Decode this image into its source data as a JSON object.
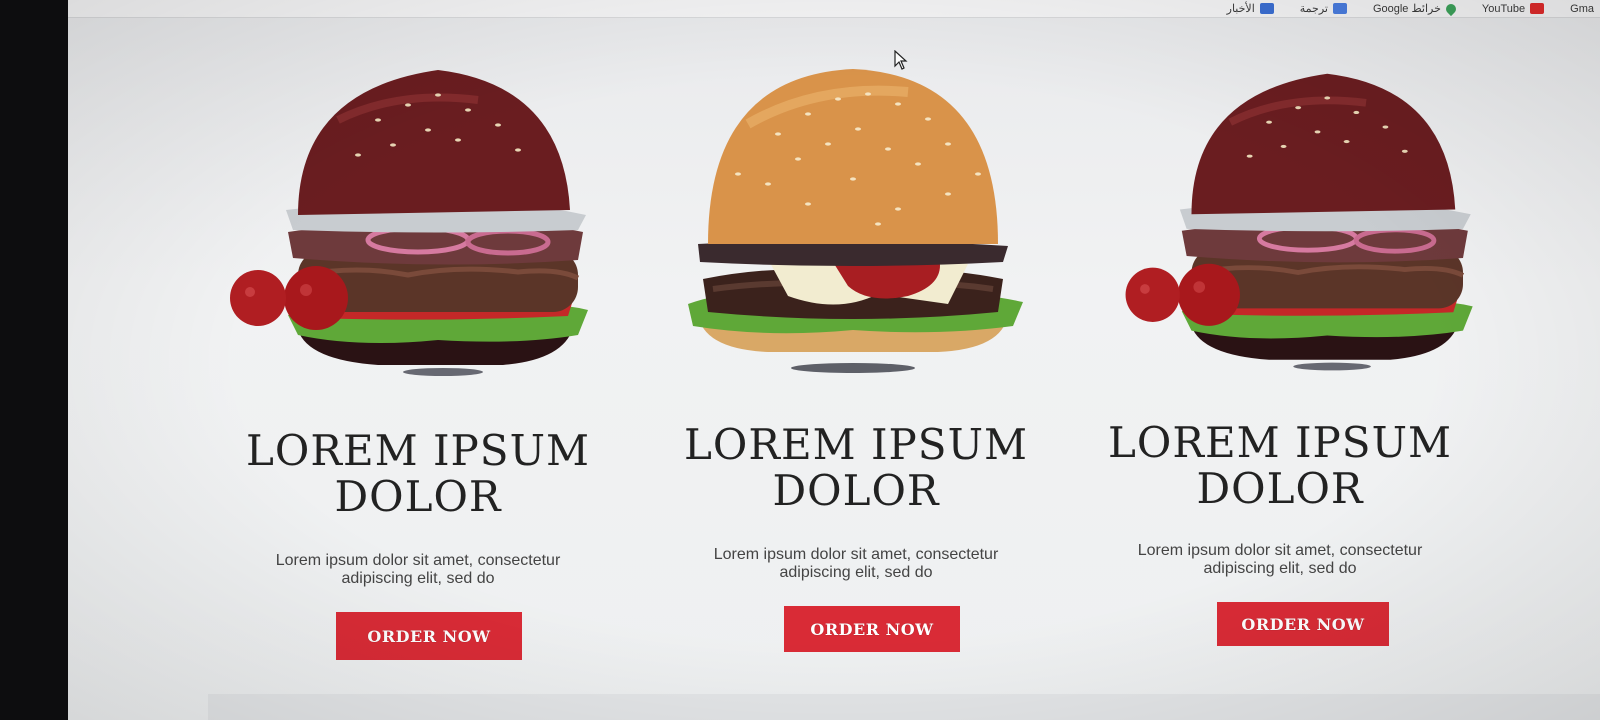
{
  "bookmarks": [
    {
      "label": "YouTube",
      "icon": "youtube-icon"
    },
    {
      "label": "Google خرائط",
      "icon": "maps-icon"
    },
    {
      "label": "ترجمة",
      "icon": "translate-icon"
    },
    {
      "label": "الأخبار",
      "icon": "news-icon"
    }
  ],
  "bookmarks_edge": "Gma",
  "products": [
    {
      "title_line1": "LOREM IPSUM",
      "title_line2": "DOLOR",
      "desc_line1": "Lorem ipsum dolor sit amet, consectetur",
      "desc_line2": "adipiscing elit, sed do",
      "button": "ORDER NOW"
    },
    {
      "title_line1": "LOREM IPSUM",
      "title_line2": "DOLOR",
      "desc_line1": "Lorem ipsum dolor sit amet, consectetur",
      "desc_line2": "adipiscing elit, sed do",
      "button": "ORDER NOW"
    },
    {
      "title_line1": "LOREM IPSUM",
      "title_line2": "DOLOR",
      "desc_line1": "Lorem ipsum dolor sit amet, consectetur",
      "desc_line2": "adipiscing elit, sed do",
      "button": "ORDER NOW"
    }
  ],
  "colors": {
    "accent": "#d92b36",
    "bun_dark": "#5a1a1c",
    "bun_light": "#d9a15c",
    "lettuce": "#5fa838",
    "tomato": "#b81c1c"
  }
}
